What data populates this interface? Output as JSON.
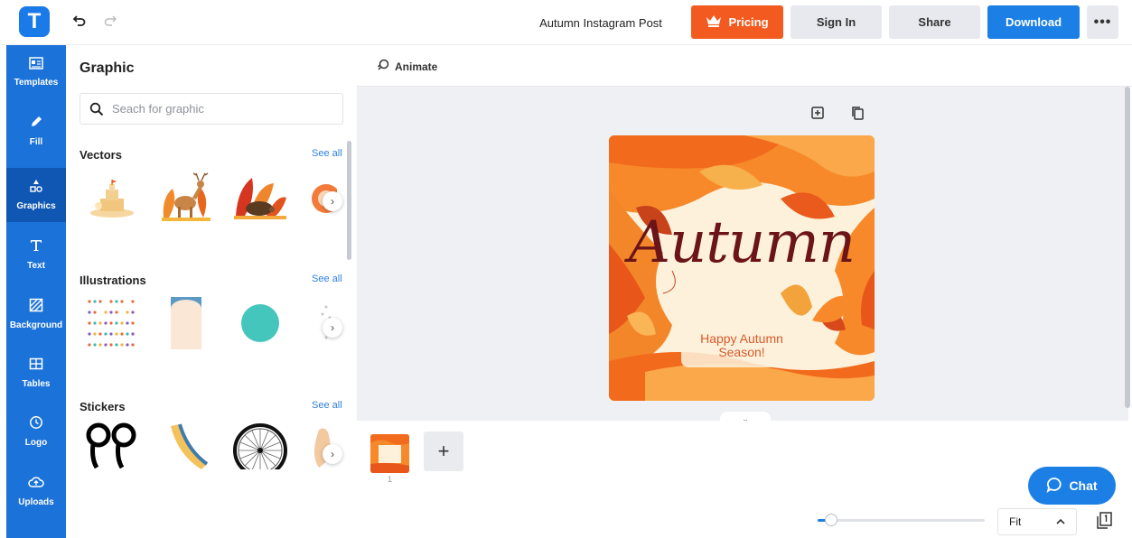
{
  "header": {
    "logo_letter": "T",
    "doc_title": "Autumn Instagram Post",
    "pricing_label": "Pricing",
    "signin_label": "Sign In",
    "share_label": "Share",
    "download_label": "Download",
    "more_label": "•••"
  },
  "rail": {
    "items": [
      {
        "label": "Templates",
        "icon": "templates-icon"
      },
      {
        "label": "Fill",
        "icon": "pencil-icon"
      },
      {
        "label": "Graphics",
        "icon": "shapes-icon",
        "active": true
      },
      {
        "label": "Text",
        "icon": "text-icon"
      },
      {
        "label": "Background",
        "icon": "background-icon"
      },
      {
        "label": "Tables",
        "icon": "table-icon"
      },
      {
        "label": "Logo",
        "icon": "logo-icon"
      },
      {
        "label": "Uploads",
        "icon": "upload-cloud-icon"
      }
    ]
  },
  "panel": {
    "title": "Graphic",
    "search_placeholder": "Seach for graphic",
    "sections": [
      {
        "title": "Vectors",
        "see_all": "See all"
      },
      {
        "title": "Illustrations",
        "see_all": "See all"
      },
      {
        "title": "Stickers",
        "see_all": "See all"
      }
    ]
  },
  "toolbar": {
    "animate_label": "Animate"
  },
  "artboard": {
    "title": "Autumn",
    "subtitle_line1": "Happy Autumn",
    "subtitle_line2": "Season!"
  },
  "pages": {
    "current_number": "1"
  },
  "footer": {
    "chat_label": "Chat",
    "zoom_value": "Fit"
  },
  "colors": {
    "brand_blue": "#1b7fe5",
    "pricing_orange": "#f25a20",
    "rail_blue": "#1b72d8",
    "rail_active": "#0f57b3"
  }
}
